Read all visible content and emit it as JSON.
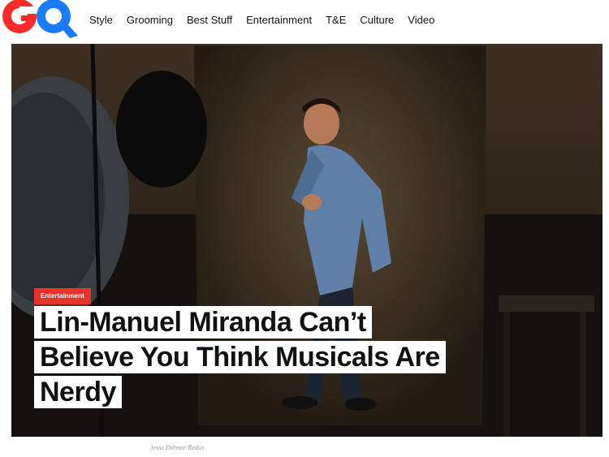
{
  "brand": {
    "logo_text": "GQ",
    "logo_colors": [
      "#ff2a2a",
      "#1a7bff"
    ]
  },
  "nav": {
    "items": [
      {
        "label": "Style"
      },
      {
        "label": "Grooming"
      },
      {
        "label": "Best Stuff"
      },
      {
        "label": "Entertainment"
      },
      {
        "label": "T&E"
      },
      {
        "label": "Culture"
      },
      {
        "label": "Video"
      }
    ]
  },
  "hero": {
    "category": "Entertainment",
    "category_color": "#e8322b",
    "headline_lines": [
      "Lin-Manuel Miranda Can’t",
      "Believe You Think Musicals Are",
      "Nerdy"
    ]
  },
  "photo_credit": "Jesse Dittmar/Redux"
}
